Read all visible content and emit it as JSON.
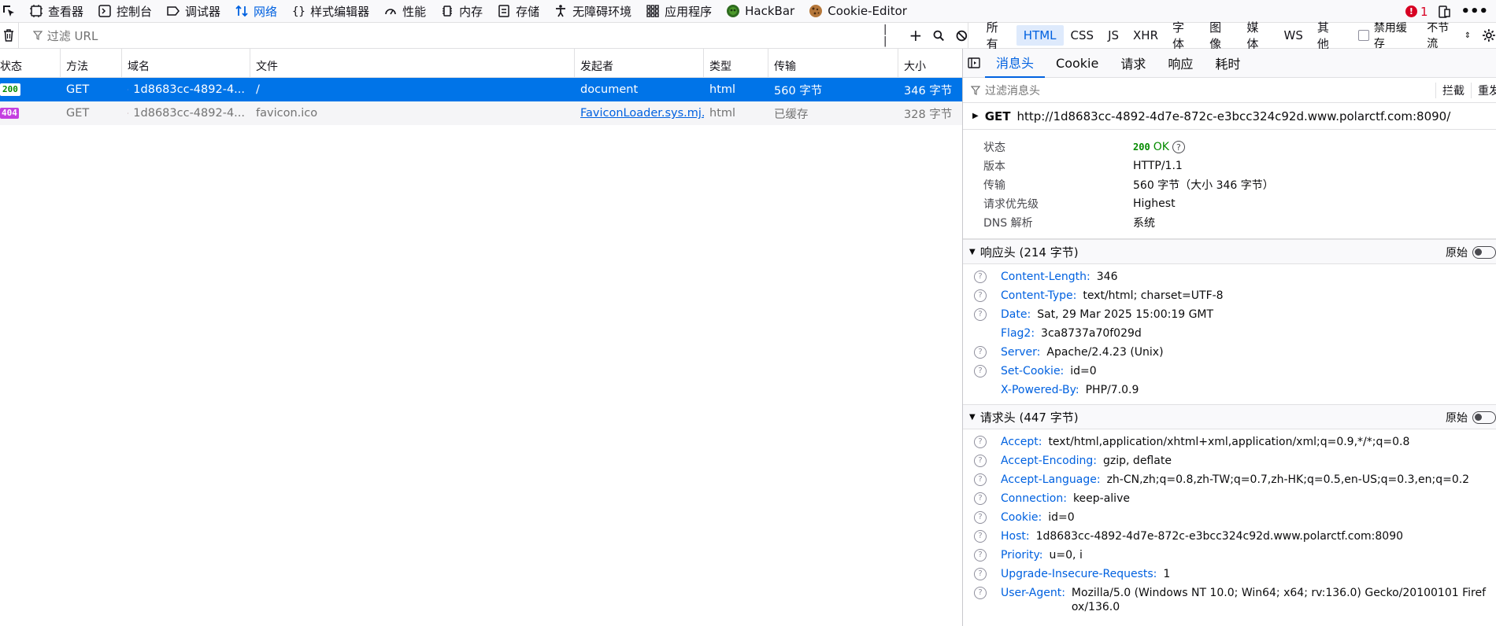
{
  "toolbar": {
    "tools": [
      {
        "label": "查看器",
        "icon": "inspector-icon"
      },
      {
        "label": "控制台",
        "icon": "console-icon"
      },
      {
        "label": "调试器",
        "icon": "debugger-icon"
      },
      {
        "label": "网络",
        "icon": "network-icon",
        "active": true
      },
      {
        "label": "样式编辑器",
        "icon": "style-editor-icon"
      },
      {
        "label": "性能",
        "icon": "performance-icon"
      },
      {
        "label": "内存",
        "icon": "memory-icon"
      },
      {
        "label": "存储",
        "icon": "storage-icon"
      },
      {
        "label": "无障碍环境",
        "icon": "accessibility-icon"
      },
      {
        "label": "应用程序",
        "icon": "application-icon"
      },
      {
        "label": "HackBar",
        "icon": "hackbar-icon"
      },
      {
        "label": "Cookie-Editor",
        "icon": "cookie-icon"
      }
    ],
    "error_count": "1"
  },
  "filter": {
    "placeholder": "过滤 URL",
    "types": [
      "所有",
      "HTML",
      "CSS",
      "JS",
      "XHR",
      "字体",
      "图像",
      "媒体",
      "WS",
      "其他"
    ],
    "active_type": "HTML",
    "disable_cache": "禁用缓存",
    "throttle": "不节流"
  },
  "table": {
    "columns": [
      "状态",
      "方法",
      "域名",
      "文件",
      "发起者",
      "类型",
      "传输",
      "大小"
    ],
    "rows": [
      {
        "status": "200",
        "method": "GET",
        "domain": "1d8683cc-4892-4...",
        "file": "/",
        "initiator": "document",
        "type": "html",
        "transfer": "560 字节",
        "size": "346 字节"
      },
      {
        "status": "404",
        "method": "GET",
        "domain": "1d8683cc-4892-4...",
        "file": "favicon.ico",
        "initiator": "FaviconLoader.sys.mj...",
        "type": "html",
        "transfer": "已缓存",
        "size": "328 字节"
      }
    ]
  },
  "panel": {
    "tabs": [
      "消息头",
      "Cookie",
      "请求",
      "响应",
      "耗时"
    ],
    "filter_placeholder": "过滤消息头",
    "block_label": "拦截",
    "resend_label": "重发",
    "method": "GET",
    "url": "http://1d8683cc-4892-4d7e-872c-e3bcc324c92d.www.polarctf.com:8090/",
    "summary": {
      "status_label": "状态",
      "status_code": "200",
      "status_text": "OK",
      "version_label": "版本",
      "version": "HTTP/1.1",
      "transfer_label": "传输",
      "transfer": "560 字节（大小 346 字节）",
      "priority_label": "请求优先级",
      "priority": "Highest",
      "dns_label": "DNS 解析",
      "dns": "系统"
    },
    "response_headers": {
      "title": "响应头 (214 字节)",
      "raw_label": "原始",
      "items": [
        {
          "name": "Content-Length:",
          "value": "346",
          "help": true
        },
        {
          "name": "Content-Type:",
          "value": "text/html; charset=UTF-8",
          "help": true
        },
        {
          "name": "Date:",
          "value": "Sat, 29 Mar 2025 15:00:19 GMT",
          "help": true
        },
        {
          "name": "Flag2:",
          "value": "3ca8737a70f029d",
          "help": false
        },
        {
          "name": "Server:",
          "value": "Apache/2.4.23 (Unix)",
          "help": true
        },
        {
          "name": "Set-Cookie:",
          "value": "id=0",
          "help": true
        },
        {
          "name": "X-Powered-By:",
          "value": "PHP/7.0.9",
          "help": false
        }
      ]
    },
    "request_headers": {
      "title": "请求头 (447 字节)",
      "raw_label": "原始",
      "items": [
        {
          "name": "Accept:",
          "value": "text/html,application/xhtml+xml,application/xml;q=0.9,*/*;q=0.8",
          "help": true
        },
        {
          "name": "Accept-Encoding:",
          "value": "gzip, deflate",
          "help": true
        },
        {
          "name": "Accept-Language:",
          "value": "zh-CN,zh;q=0.8,zh-TW;q=0.7,zh-HK;q=0.5,en-US;q=0.3,en;q=0.2",
          "help": true
        },
        {
          "name": "Connection:",
          "value": "keep-alive",
          "help": true
        },
        {
          "name": "Cookie:",
          "value": "id=0",
          "help": true
        },
        {
          "name": "Host:",
          "value": "1d8683cc-4892-4d7e-872c-e3bcc324c92d.www.polarctf.com:8090",
          "help": true
        },
        {
          "name": "Priority:",
          "value": "u=0, i",
          "help": true
        },
        {
          "name": "Upgrade-Insecure-Requests:",
          "value": "1",
          "help": true
        },
        {
          "name": "User-Agent:",
          "value": "Mozilla/5.0 (Windows NT 10.0; Win64; x64; rv:136.0) Gecko/20100101 Firefox/136.0",
          "help": true
        }
      ]
    }
  },
  "colors": {
    "accent": "#0061e0",
    "selected_row": "#0074e8",
    "status_404": "#c43fe0",
    "status_ok": "#12bc00"
  }
}
